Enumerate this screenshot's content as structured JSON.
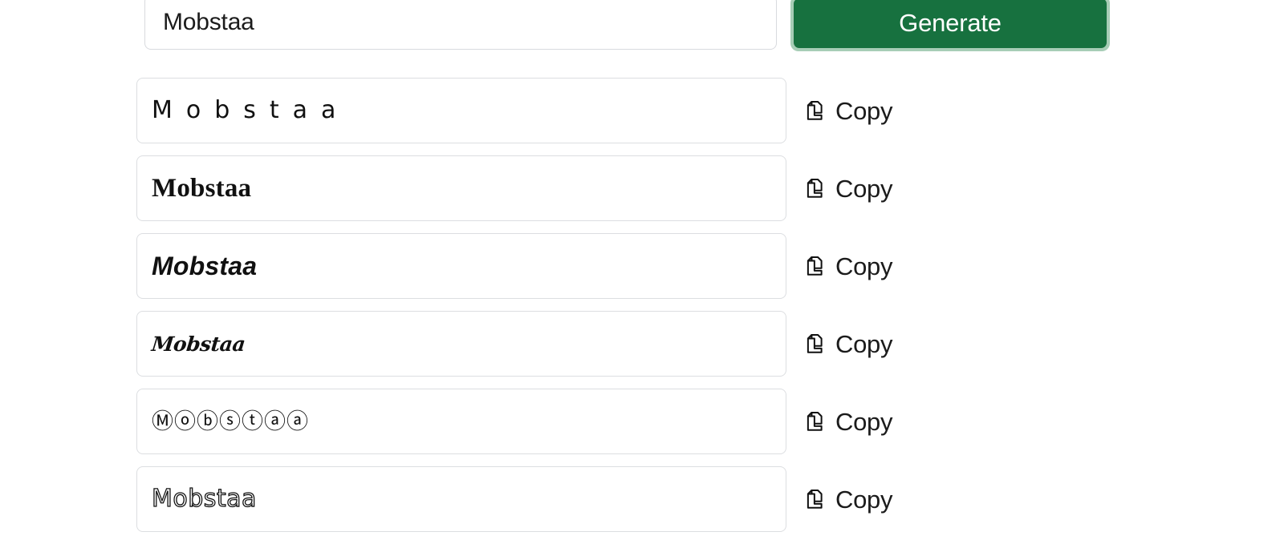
{
  "background_color": "#ffffff",
  "generator": {
    "input": {
      "value": "Mobstaa",
      "placeholder": "Enter your name"
    },
    "generate_label": "Generate",
    "accent_color": "#17713f",
    "focus_ring_color": "#a7cdb6"
  },
  "copy_label": "Copy",
  "copy_icon_name": "copy-icon",
  "results": [
    {
      "style": "wide-spaced",
      "text": "Mobstaa"
    },
    {
      "style": "serif-bold",
      "text": "Mobstaa"
    },
    {
      "style": "sans-bold-italic",
      "text": "Mobstaa"
    },
    {
      "style": "script-bold",
      "text": "Mobstaa"
    },
    {
      "style": "circled",
      "text": "Ⓜⓞⓑⓢⓣⓐⓐ"
    },
    {
      "style": "outline",
      "text": "Mobstaa"
    }
  ]
}
